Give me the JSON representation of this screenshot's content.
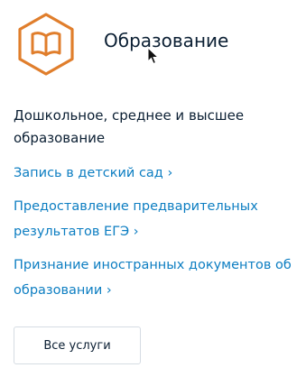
{
  "service_card": {
    "icon": "book-icon",
    "accent_color": "#e07e2c",
    "title": "Образование",
    "description": "Дошкольное, среднее и высшее образование",
    "links": [
      {
        "label": "Запись в детский сад ›"
      },
      {
        "label": "Предоставление предварительных результатов ЕГЭ ›"
      },
      {
        "label": "Признание иностранных документов об образовании ›"
      }
    ],
    "all_services_label": "Все услуги",
    "link_color": "#0d7ec2"
  }
}
